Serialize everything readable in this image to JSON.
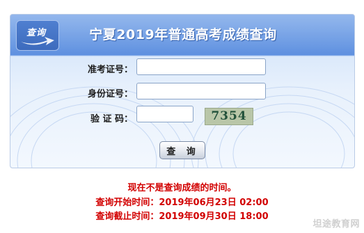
{
  "header": {
    "badge_label": "查询",
    "title": "宁夏2019年普通高考成绩查询"
  },
  "form": {
    "exam_number": {
      "label": "准考证号：",
      "value": "",
      "placeholder": ""
    },
    "id_number": {
      "label": "身份证号：",
      "value": "",
      "placeholder": ""
    },
    "captcha": {
      "label": "验 证 码：",
      "value": "",
      "placeholder": "",
      "code": "7354"
    },
    "submit_label": "查 询"
  },
  "notice": {
    "line1": "现在不是查询成绩的时间。",
    "line2": "查询开始时间：2019年06月23日 02:00",
    "line3": "查询截止时间：2019年09月30日 18:00"
  },
  "watermark": "坦途教育网",
  "colors": {
    "header_blue": "#5e90e0",
    "notice_red": "#d20000",
    "captcha_bg": "#b9c6a8"
  }
}
